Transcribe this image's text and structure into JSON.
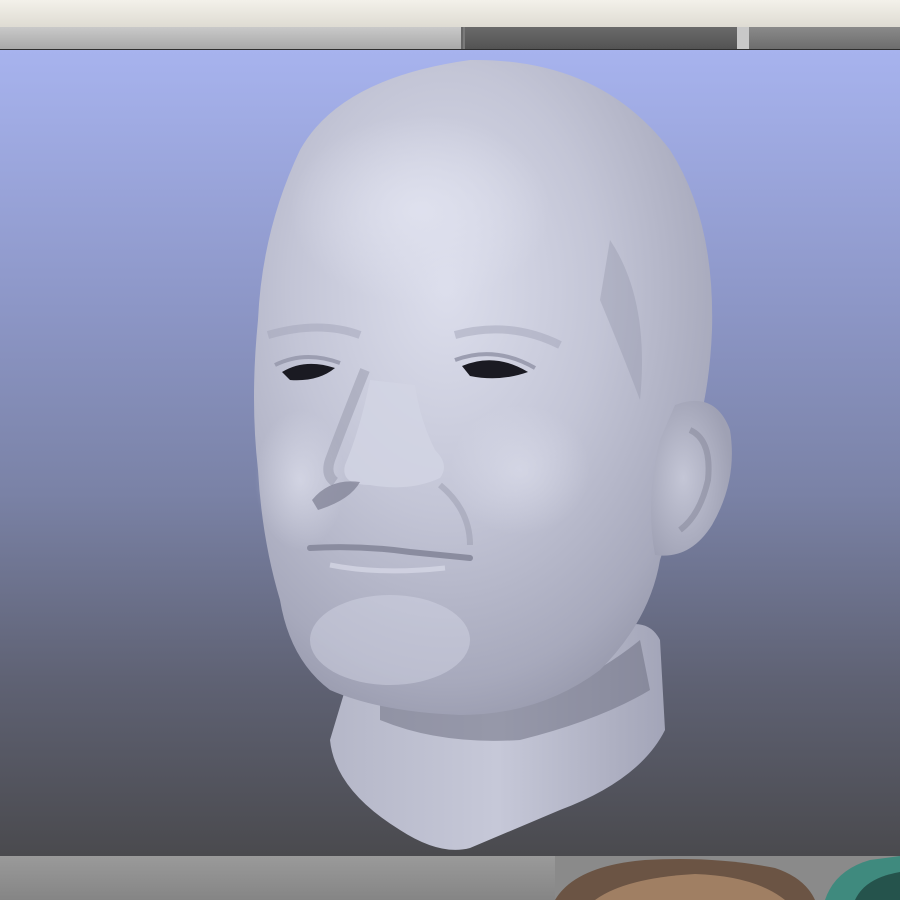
{
  "app": {
    "tabs": [
      {
        "name": "tab-1"
      },
      {
        "name": "tab-2"
      },
      {
        "name": "tab-3"
      },
      {
        "name": "tab-4"
      }
    ]
  },
  "viewport": {
    "subject": "3d-head-model",
    "model_color": "#c6c8d8",
    "background_top": "#a7b3ee",
    "background_bottom": "#4a4a4e"
  },
  "thumbnail": {
    "subject": "photo-thumbnail"
  }
}
